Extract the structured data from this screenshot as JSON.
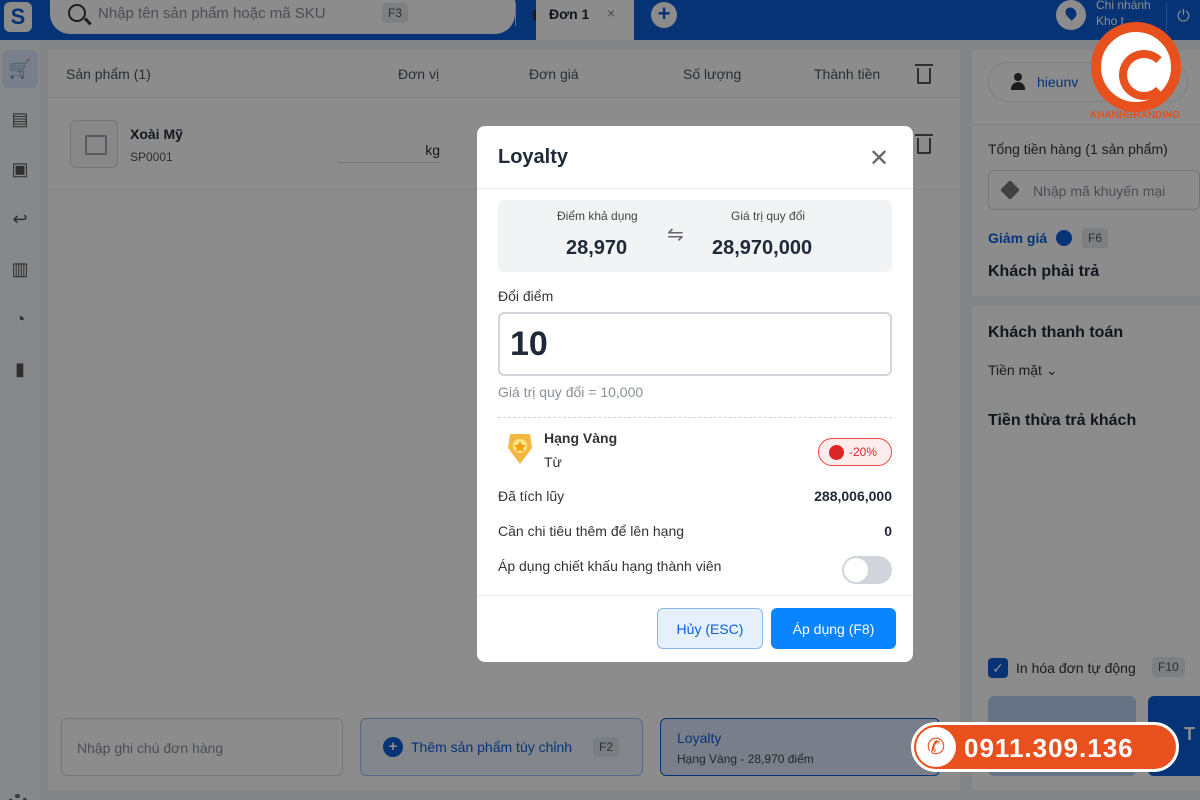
{
  "search": {
    "placeholder": "Nhập tên sản phẩm hoặc mã SKU",
    "shortcut": "F3"
  },
  "tabs": {
    "active_label": "Đơn 1",
    "close_glyph": "×",
    "add_glyph": "+"
  },
  "branch": {
    "line1": "Chi nhánh",
    "line2": "Kho t..."
  },
  "table": {
    "headers": {
      "product": "Sản phẩm (1)",
      "unit": "Đơn vị",
      "price": "Đơn giá",
      "qty": "Số lượng",
      "total": "Thành tiền"
    },
    "rows": [
      {
        "name": "Xoài Mỹ",
        "sku": "SP0001",
        "unit": "kg"
      }
    ]
  },
  "bottom": {
    "note_placeholder": "Nhập ghi chú đơn hàng",
    "add_custom_label": "Thêm sản phẩm tùy chỉnh",
    "add_custom_key": "F2",
    "loyalty_title": "Loyalty",
    "loyalty_sub": "Hạng Vàng - 28,970 điểm"
  },
  "right": {
    "user": "hieunv",
    "total_label": "Tổng tiền hàng (1 sản phẩm)",
    "promo_placeholder": "Nhập mã khuyến mại",
    "discount_label": "Giảm giá",
    "discount_key": "F6",
    "must_pay": "Khách phải trả",
    "customer_pays": "Khách thanh toán",
    "payment_method": "Tiền mặt",
    "change_label": "Tiền thừa trả khách",
    "print_label": "In hóa đơn tự động",
    "print_key": "F10",
    "pay_initial": "T"
  },
  "modal": {
    "title": "Loyalty",
    "available_points_label": "Điểm khả dụng",
    "available_points": "28,970",
    "exchange_value_label": "Giá trị quy đổi",
    "exchange_value": "28,970,000",
    "redeem_label": "Đổi điểm",
    "redeem_value": "10",
    "redeem_hint": "Giá trị quy đổi = 10,000",
    "rank_name": "Hạng Vàng",
    "rank_from": "Từ",
    "rank_discount": "-20%",
    "accumulated_label": "Đã tích lũy",
    "accumulated_value": "288,006,000",
    "to_next_label": "Cần chi tiêu thêm để lên hạng",
    "to_next_value": "0",
    "apply_discount_label": "Áp dụng chiết khấu hạng thành viên",
    "cancel_label": "Hủy (ESC)",
    "apply_label": "Áp dụng (F8)"
  },
  "watermark": {
    "brand": "KHANHBRANDING",
    "phone": "0911.309.136"
  },
  "colors": {
    "primary": "#0b5ed7",
    "accent": "#0a84ff",
    "danger": "#dc2626",
    "brand_orange": "#e8501e"
  }
}
